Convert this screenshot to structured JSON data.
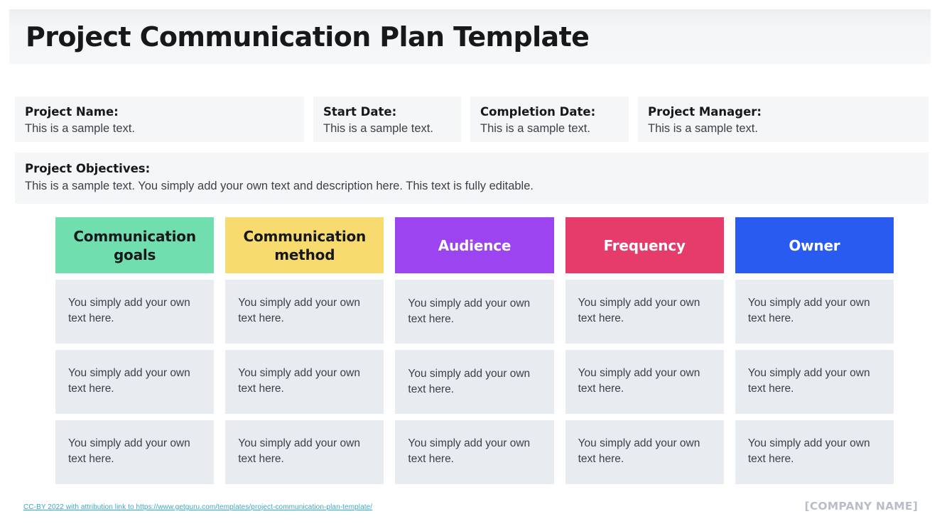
{
  "document": {
    "title": "Project Communication Plan Template"
  },
  "info_fields": [
    {
      "label": "Project Name:",
      "value": "This is a sample text."
    },
    {
      "label": "Start Date:",
      "value": "This is a sample text."
    },
    {
      "label": "Completion Date:",
      "value": "This is a sample text."
    },
    {
      "label": "Project Manager:",
      "value": "This is a sample text."
    }
  ],
  "objectives": {
    "label": "Project Objectives:",
    "value": "This is a sample text. You simply add your own text and description here. This text is fully editable."
  },
  "matrix": {
    "headers": [
      {
        "label": "Communication goals",
        "bg": "#71DEAF",
        "fg": "#16181c"
      },
      {
        "label": "Communication method",
        "bg": "#F7DB6E",
        "fg": "#16181c"
      },
      {
        "label": "Audience",
        "bg": "#9B44F0",
        "fg": "#ffffff"
      },
      {
        "label": "Frequency",
        "bg": "#E63C6B",
        "fg": "#ffffff"
      },
      {
        "label": "Owner",
        "bg": "#2A5BF0",
        "fg": "#ffffff"
      }
    ],
    "cell_bg": "#E8EBEF",
    "rows": [
      [
        "You simply add your own text here.",
        "You simply add your own text here.",
        "You simply add your own text here.",
        "You simply add your own text here.",
        "You simply add your own text here."
      ],
      [
        "You simply add your own text here.",
        "You simply add your own text here.",
        "You simply add your own text here.",
        "You simply add your own text here.",
        "You simply add your own text here."
      ],
      [
        "You simply add your own text here.",
        "You simply add your own text here.",
        "You simply add your own text here.",
        "You simply add your own text here.",
        "You simply add your own text here."
      ]
    ]
  },
  "footer": {
    "attribution": "CC-BY 2022 with attribution link to https://www.getguru.com/templates/project-communication-plan-template/",
    "company_placeholder": "[COMPANY NAME]"
  }
}
